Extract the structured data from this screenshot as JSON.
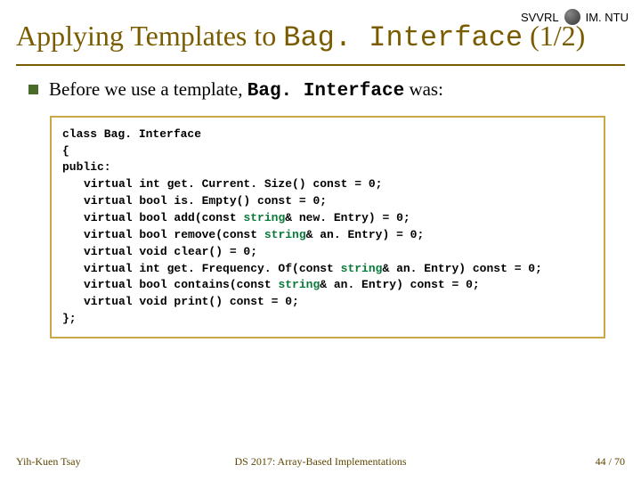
{
  "header": {
    "org_left": "SVVRL",
    "org_right": "IM. NTU"
  },
  "title": {
    "prefix": "Applying Templates to ",
    "mono": "Bag. Interface",
    "suffix": " (1/2)"
  },
  "bullet": {
    "prefix": "Before we use a template, ",
    "mono": "Bag. Interface",
    "suffix": " was:"
  },
  "code": {
    "l1": "class Bag. Interface",
    "l2": "{",
    "l3": "public:",
    "l4a": "virtual int get. Current. Size() const = 0;",
    "l5a": "virtual bool is. Empty() const = 0;",
    "l6a": "virtual bool add(const ",
    "l6b": "string",
    "l6c": "& new. Entry) = 0;",
    "l7a": "virtual bool remove(const ",
    "l7b": "string",
    "l7c": "& an. Entry) = 0;",
    "l8a": "virtual void clear() = 0;",
    "l9a": "virtual int get. Frequency. Of(const ",
    "l9b": "string",
    "l9c": "& an. Entry) const = 0;",
    "l10a": "virtual bool contains(const ",
    "l10b": "string",
    "l10c": "& an. Entry) const = 0;",
    "l11a": "virtual void print() const = 0;",
    "l12": "};"
  },
  "footer": {
    "left": "Yih-Kuen Tsay",
    "center": "DS 2017: Array-Based Implementations",
    "right": "44 / 70"
  }
}
